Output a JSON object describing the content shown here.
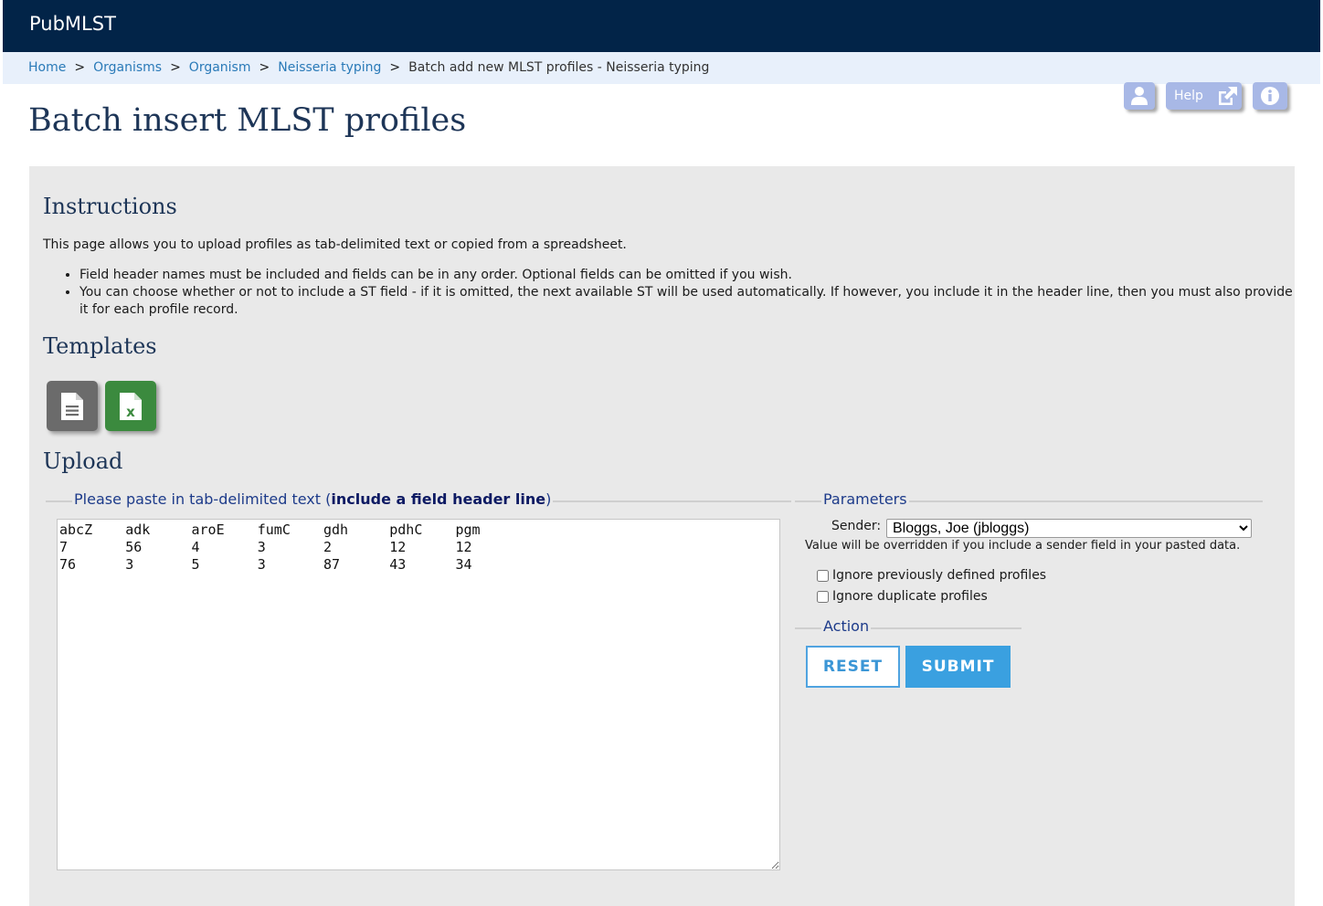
{
  "header": {
    "brand": "PubMLST"
  },
  "breadcrumb": {
    "items": [
      "Home",
      "Organisms",
      "Organism",
      "Neisseria typing"
    ],
    "separator": ">",
    "current": "Batch add new MLST profiles - Neisseria typing"
  },
  "toolbar": {
    "help_label": "Help"
  },
  "page": {
    "title": "Batch insert MLST profiles"
  },
  "instructions": {
    "heading": "Instructions",
    "intro": "This page allows you to upload profiles as tab-delimited text or copied from a spreadsheet.",
    "bullets": [
      "Field header names must be included and fields can be in any order. Optional fields can be omitted if you wish.",
      "You can choose whether or not to include a ST field - if it is omitted, the next available ST will be used automatically. If however, you include it in the header line, then you must also provide it for each profile record."
    ]
  },
  "templates": {
    "heading": "Templates",
    "xls_letter": "x"
  },
  "upload": {
    "heading": "Upload",
    "paste_legend_prefix": "Please paste in tab-delimited text (",
    "paste_legend_bold": "include a field header line",
    "paste_legend_suffix": ")",
    "paste_text": "abcZ\tadk\taroE\tfumC\tgdh\tpdhC\tpgm\n7\t56\t4\t3\t2\t12\t12\n76\t3\t5\t3\t87\t43\t34"
  },
  "parameters": {
    "legend": "Parameters",
    "sender_label": "Sender:",
    "sender_value": "Bloggs, Joe (jbloggs)",
    "sender_note": "Value will be overridden if you include a sender field in your pasted data.",
    "ignore_previous_label": "Ignore previously defined profiles",
    "ignore_duplicate_label": "Ignore duplicate profiles",
    "ignore_previous_checked": false,
    "ignore_duplicate_checked": false
  },
  "action": {
    "legend": "Action",
    "reset_label": "RESET",
    "submit_label": "SUBMIT"
  },
  "colors": {
    "topbar": "#022448",
    "breadcrumb_bg": "#e8f0fb",
    "link": "#2a7ab8",
    "panel_bg": "#e9e9e9",
    "accent": "#3aa0e0",
    "excel_green": "#3b8a3e"
  },
  "icons": [
    "user-icon",
    "external-link-icon",
    "info-icon",
    "text-file-icon",
    "excel-file-icon"
  ]
}
